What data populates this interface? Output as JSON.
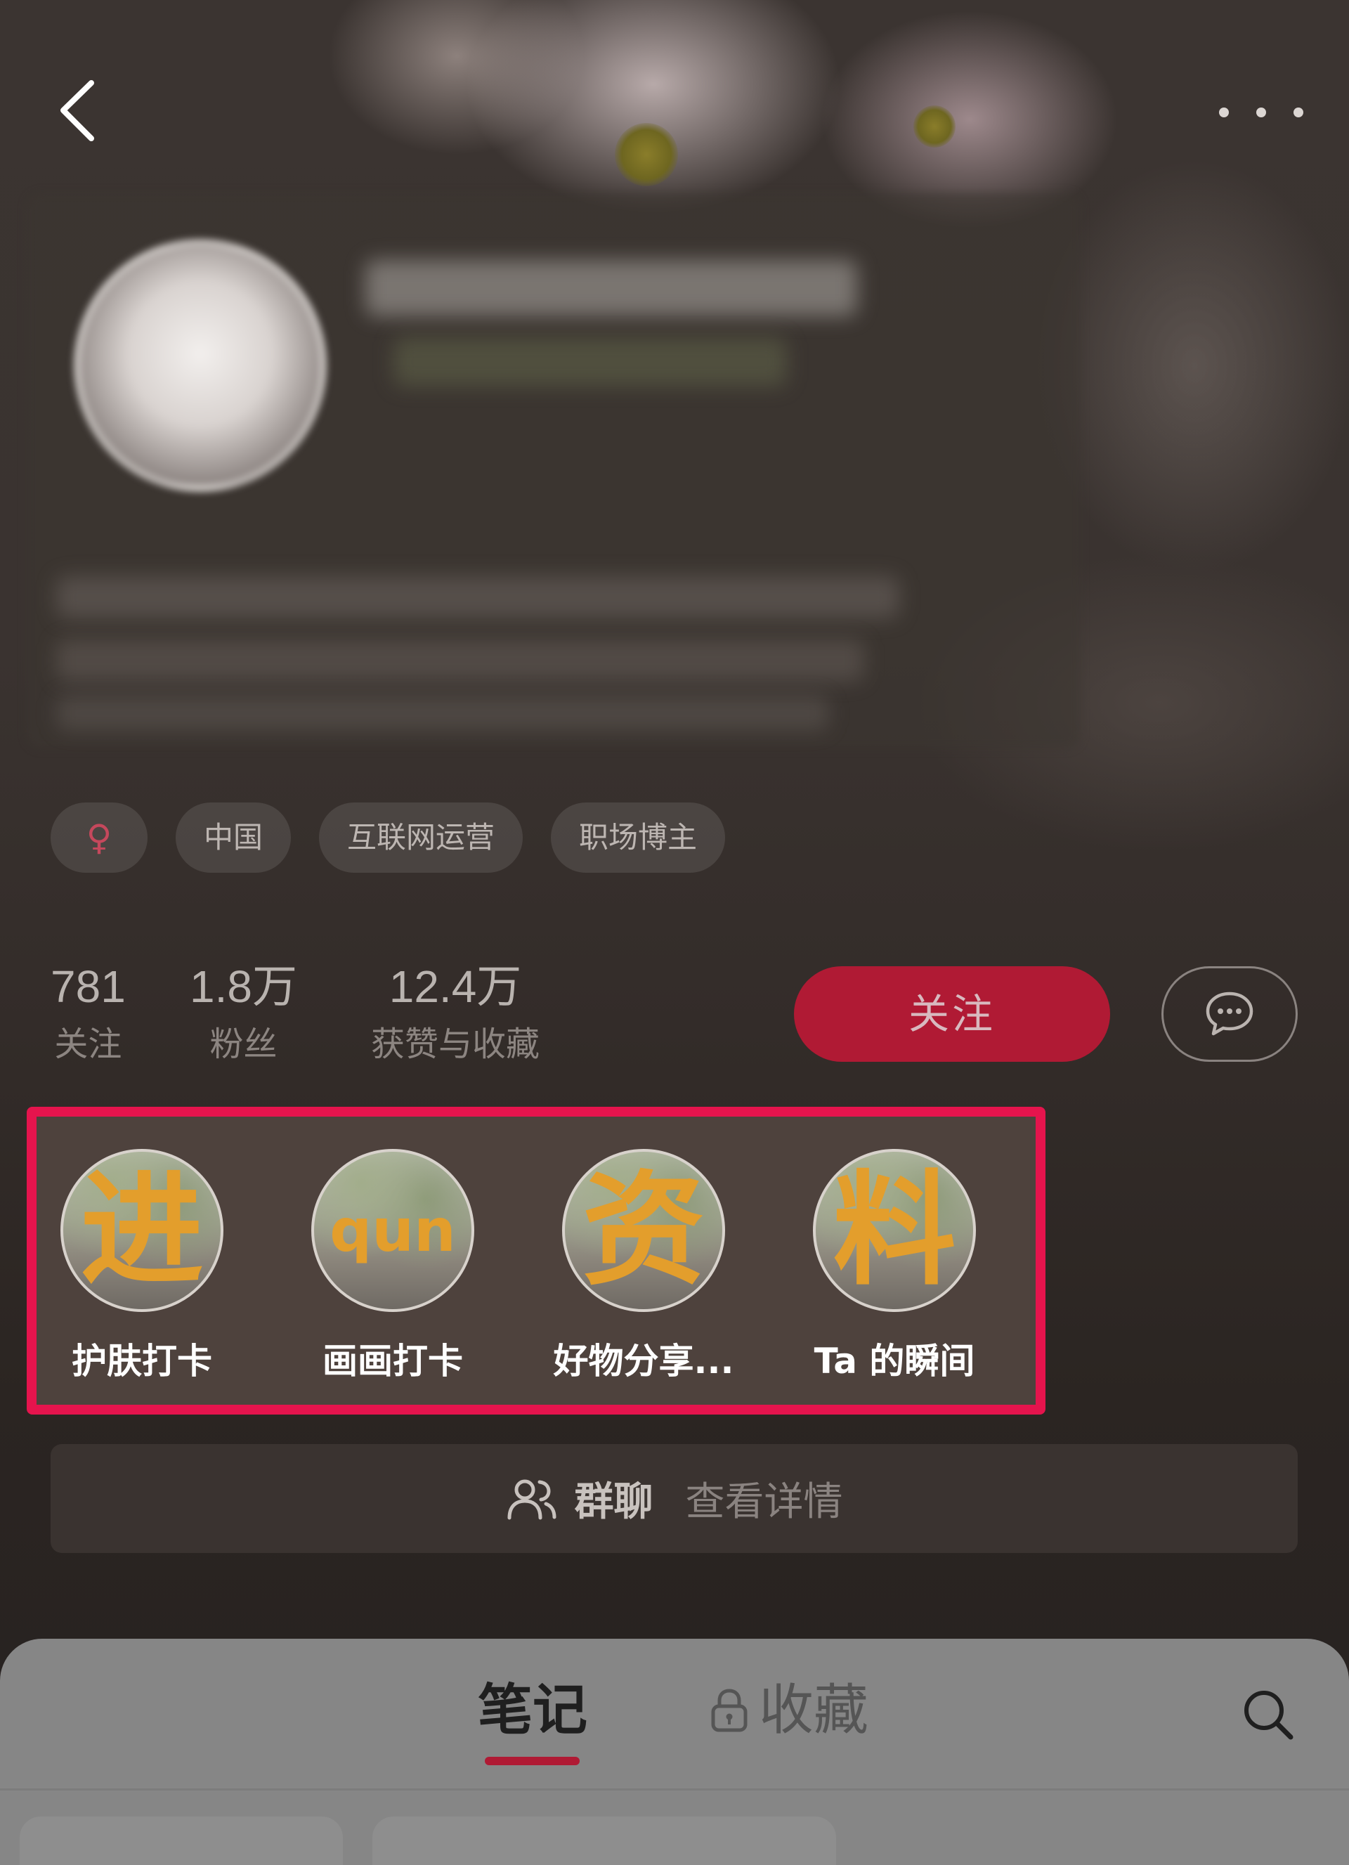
{
  "tags": [
    {
      "label": "♀"
    },
    {
      "label": "中国"
    },
    {
      "label": "互联网运营"
    },
    {
      "label": "职场博主"
    }
  ],
  "stats": {
    "following": {
      "value": "781",
      "label": "关注"
    },
    "fans": {
      "value": "1.8万",
      "label": "粉丝"
    },
    "likes": {
      "value": "12.4万",
      "label": "获赞与收藏"
    }
  },
  "follow_button": "关注",
  "stories": [
    {
      "glyph": "进",
      "label": "护肤打卡"
    },
    {
      "glyph": "qun",
      "label": "画画打卡"
    },
    {
      "glyph": "资",
      "label": "好物分享..."
    },
    {
      "glyph": "料",
      "label": "Ta 的瞬间"
    }
  ],
  "group_chat": {
    "title": "群聊",
    "action": "查看详情"
  },
  "tabs": {
    "notes": "笔记",
    "favorites": "收藏"
  },
  "colors": {
    "accent": "#b01a34",
    "highlight_border": "#e5144d",
    "story_glyph": "#e39e2c"
  },
  "icons": [
    "back-icon",
    "more-icon",
    "message-icon",
    "group-icon",
    "lock-icon",
    "search-icon"
  ]
}
